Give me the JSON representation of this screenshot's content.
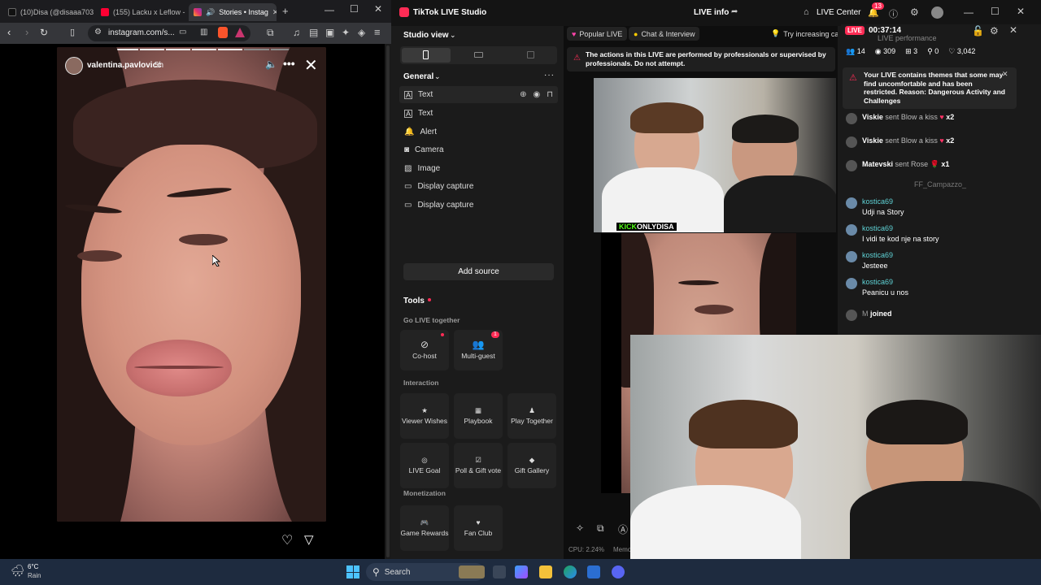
{
  "browser": {
    "tabs": [
      {
        "label": "(10)Disa (@disaaa703",
        "favicon_color": "#000000"
      },
      {
        "label": "(155) Lacku x Leflow -",
        "favicon_color": "#ff0033"
      },
      {
        "label": "Stories • Instag",
        "favicon_color": "#e1306c"
      }
    ],
    "url": "instagram.com/s...",
    "story": {
      "username": "valentina.pavlovicc",
      "time": "5h"
    }
  },
  "tiktok": {
    "app_title": "TikTok LIVE Studio",
    "live_info": "LIVE info",
    "live_center": "LIVE Center",
    "notification_count": "13",
    "studio_view": "Studio view",
    "general": "General",
    "sources": [
      {
        "label": "Text",
        "icon": "text-icon"
      },
      {
        "label": "Text",
        "icon": "text-icon"
      },
      {
        "label": "Alert",
        "icon": "bell-icon"
      },
      {
        "label": "Camera",
        "icon": "camera-icon"
      },
      {
        "label": "Image",
        "icon": "image-icon"
      },
      {
        "label": "Display capture",
        "icon": "monitor-icon"
      },
      {
        "label": "Display capture",
        "icon": "monitor-icon"
      }
    ],
    "add_source": "Add source",
    "tools": "Tools",
    "go_live_together": "Go LIVE together",
    "cohost": "Co-host",
    "multiguest": "Multi-guest",
    "multiguest_badge": "1",
    "interaction": "Interaction",
    "viewer_wishes": "Viewer Wishes",
    "playbook": "Playbook",
    "play_together": "Play Together",
    "live_goal": "LIVE Goal",
    "poll_gift": "Poll & Gift vote",
    "gift_gallery": "Gift Gallery",
    "monetization": "Monetization",
    "game_rewards": "Game Rewards",
    "fan_club": "Fan Club",
    "popular_live": "Popular LIVE",
    "chat_interview": "Chat & Interview",
    "tip": "Try increasing camera",
    "warning": "The actions in this LIVE are performed by professionals or supervised by professionals. Do not attempt.",
    "kick_label": "KICK",
    "kick_name": "ONLYDISA",
    "cpu": "CPU: 2.24%",
    "memory": "Memo"
  },
  "live": {
    "badge": "LIVE",
    "timer": "00:37:14",
    "performance": "LIVE performance",
    "stats": {
      "viewers": "14",
      "views": "309",
      "shares": "3",
      "followers": "0",
      "likes": "3,042"
    },
    "restriction": "Your LIVE contains themes that some may find uncomfortable and has been restricted. Reason: Dangerous Activity and Challenges",
    "gifts": [
      {
        "user": "Viskie",
        "text": "sent Blow a kiss",
        "count": "x2"
      },
      {
        "user": "Viskie",
        "text": "sent Blow a kiss",
        "count": "x2"
      },
      {
        "user": "Matevski",
        "text": "sent Rose",
        "count": "x1"
      }
    ],
    "faded_user": "FF_Campazzo_",
    "comments": [
      {
        "user": "kostica69",
        "text": "Udji na Story"
      },
      {
        "user": "kostica69",
        "text": "I vidi te kod nje na story"
      },
      {
        "user": "kostica69",
        "text": "Jesteee"
      },
      {
        "user": "kostica69",
        "text": "Peanicu u nos"
      }
    ],
    "joined": {
      "user": "M",
      "text": "joined"
    }
  },
  "taskbar": {
    "temp": "6°C",
    "weather": "Rain",
    "search": "Search"
  }
}
